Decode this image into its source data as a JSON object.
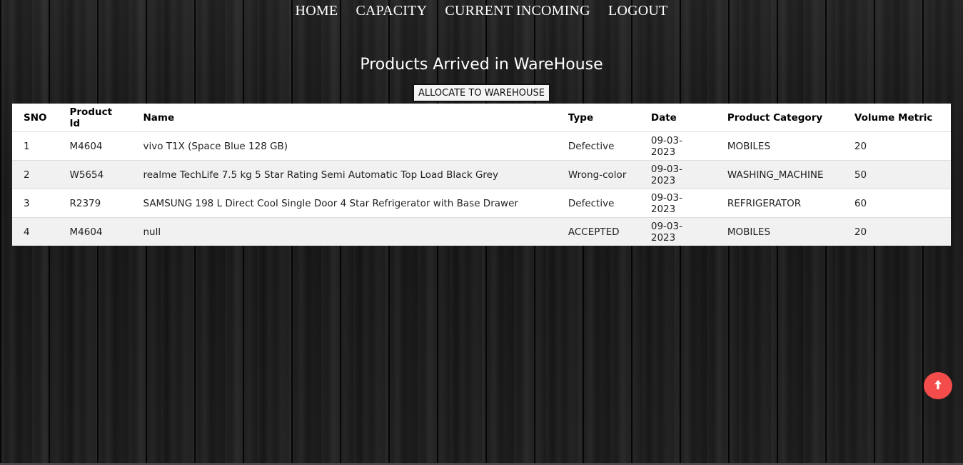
{
  "nav": {
    "items": [
      "HOME",
      "CAPACITY",
      "CURRENT INCOMING",
      "LOGOUT"
    ]
  },
  "page": {
    "title": "Products Arrived in WareHouse",
    "allocate_label": "ALLOCATE TO WAREHOUSE"
  },
  "table": {
    "headers": [
      "SNO",
      "Product Id",
      "Name",
      "Type",
      "Date",
      "Product Category",
      "Volume Metric"
    ],
    "rows": [
      [
        "1",
        "M4604",
        "vivo T1X (Space Blue 128 GB)",
        "Defective",
        "09-03-2023",
        "MOBILES",
        "20"
      ],
      [
        "2",
        "W5654",
        "realme TechLife 7.5 kg 5 Star Rating Semi Automatic Top Load Black Grey",
        "Wrong-color",
        "09-03-2023",
        "WASHING_MACHINE",
        "50"
      ],
      [
        "3",
        "R2379",
        "SAMSUNG 198 L Direct Cool Single Door 4 Star Refrigerator with Base Drawer",
        "Defective",
        "09-03-2023",
        "REFRIGERATOR",
        "60"
      ],
      [
        "4",
        "M4604",
        "null",
        "ACCEPTED",
        "09-03-2023",
        "MOBILES",
        "20"
      ]
    ]
  },
  "scroll_top": {
    "icon": "arrow-up-icon",
    "color": "#f44b4b"
  }
}
